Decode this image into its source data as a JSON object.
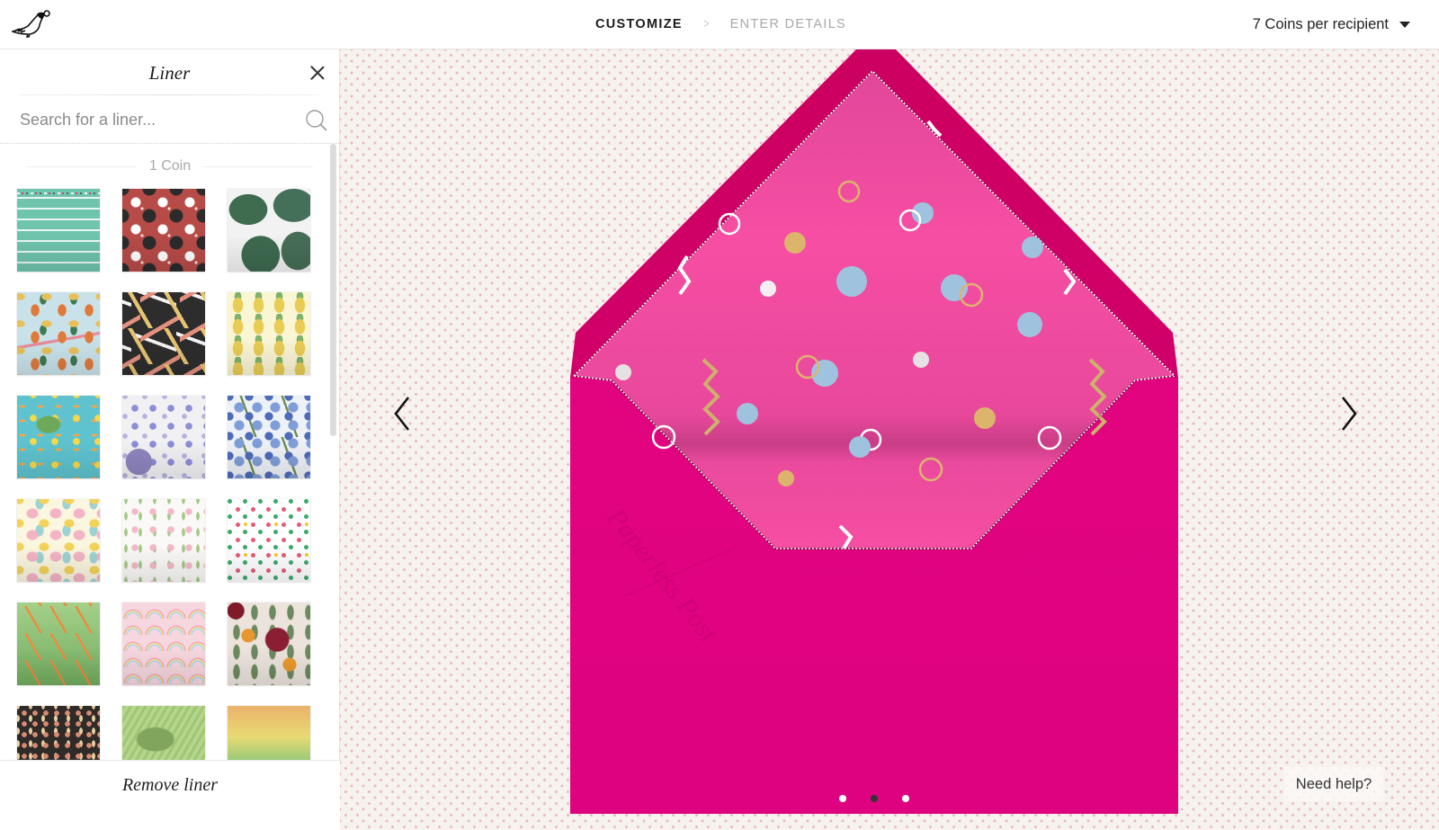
{
  "header": {
    "logo": "bird-logo",
    "steps": [
      {
        "label": "CUSTOMIZE",
        "state": "active"
      },
      {
        "label": "ENTER DETAILS",
        "state": "inactive"
      }
    ],
    "step_separator_icon": "chevron-right-icon",
    "coins_label": "7 Coins per recipient",
    "coins_caret_icon": "caret-down-icon"
  },
  "sidebar": {
    "title": "Liner",
    "close_icon": "close-icon",
    "search": {
      "placeholder": "Search for a liner...",
      "value": "",
      "icon": "search-icon"
    },
    "sections": [
      {
        "label": "1 Coin",
        "liners": [
          {
            "name": "teal-typewriter-text",
            "colors": [
              "#6fc4ae",
              "#ffffff",
              "#e62878"
            ]
          },
          {
            "name": "french-bulldog-cats",
            "colors": [
              "#b74b48",
              "#2b2b2b",
              "#ffffff"
            ]
          },
          {
            "name": "monstera-leaves",
            "colors": [
              "#f2f2f2",
              "#3f6b4f"
            ]
          },
          {
            "name": "insects",
            "colors": [
              "#c9e2ea",
              "#e07a3b",
              "#e8c05a"
            ]
          },
          {
            "name": "party-cocktails",
            "colors": [
              "#2d2d2d",
              "#e6c371",
              "#e3907f"
            ]
          },
          {
            "name": "pineapples",
            "colors": [
              "#faf6d4",
              "#e8cc54",
              "#7eb26a"
            ]
          },
          {
            "name": "sea-turtles",
            "colors": [
              "#5ec3cf",
              "#6ea95a",
              "#f5d94a"
            ]
          },
          {
            "name": "pressed-violets",
            "colors": [
              "#f1f1f4",
              "#8c8ed6"
            ]
          },
          {
            "name": "hydrangea-ferns",
            "colors": [
              "#eef1f7",
              "#4e6bb8",
              "#6a8c4e"
            ]
          },
          {
            "name": "baby-clothes",
            "colors": [
              "#fbf6df",
              "#f4b4c6",
              "#9fd2d4"
            ]
          },
          {
            "name": "delicate-floral",
            "colors": [
              "#fbf9f7",
              "#f3b9c7",
              "#a4c98a"
            ]
          },
          {
            "name": "rainbow-polka-dots",
            "colors": [
              "#ffffff",
              "#e65c7a",
              "#3daa6a",
              "#f2cb33"
            ]
          },
          {
            "name": "carrots-on-green",
            "colors": [
              "#a5d08a",
              "#ee8a3e"
            ]
          },
          {
            "name": "rainbows-on-pink",
            "colors": [
              "#f6d6df",
              "#a9d9f2",
              "#f6e48a"
            ]
          },
          {
            "name": "autumn-bouquet",
            "colors": [
              "#ece3dd",
              "#8a1f34",
              "#e8962f"
            ]
          },
          {
            "name": "dark-floral",
            "colors": [
              "#2e2b28",
              "#d98a73"
            ]
          },
          {
            "name": "palm-fronds",
            "colors": [
              "#9fc676",
              "#82a55e"
            ]
          },
          {
            "name": "sunset-ombre",
            "colors": [
              "#eab26b",
              "#e8da72",
              "#96c97a"
            ]
          }
        ]
      }
    ],
    "remove_label": "Remove liner"
  },
  "preview": {
    "prev_icon": "chevron-left-icon",
    "next_icon": "chevron-right-icon",
    "envelope_color": "#e0037f",
    "liner_color": "#f24a9e",
    "embossed_brand": "Paperless Post",
    "pagination": {
      "total": 3,
      "current": 2
    },
    "help_label": "Need help?"
  }
}
